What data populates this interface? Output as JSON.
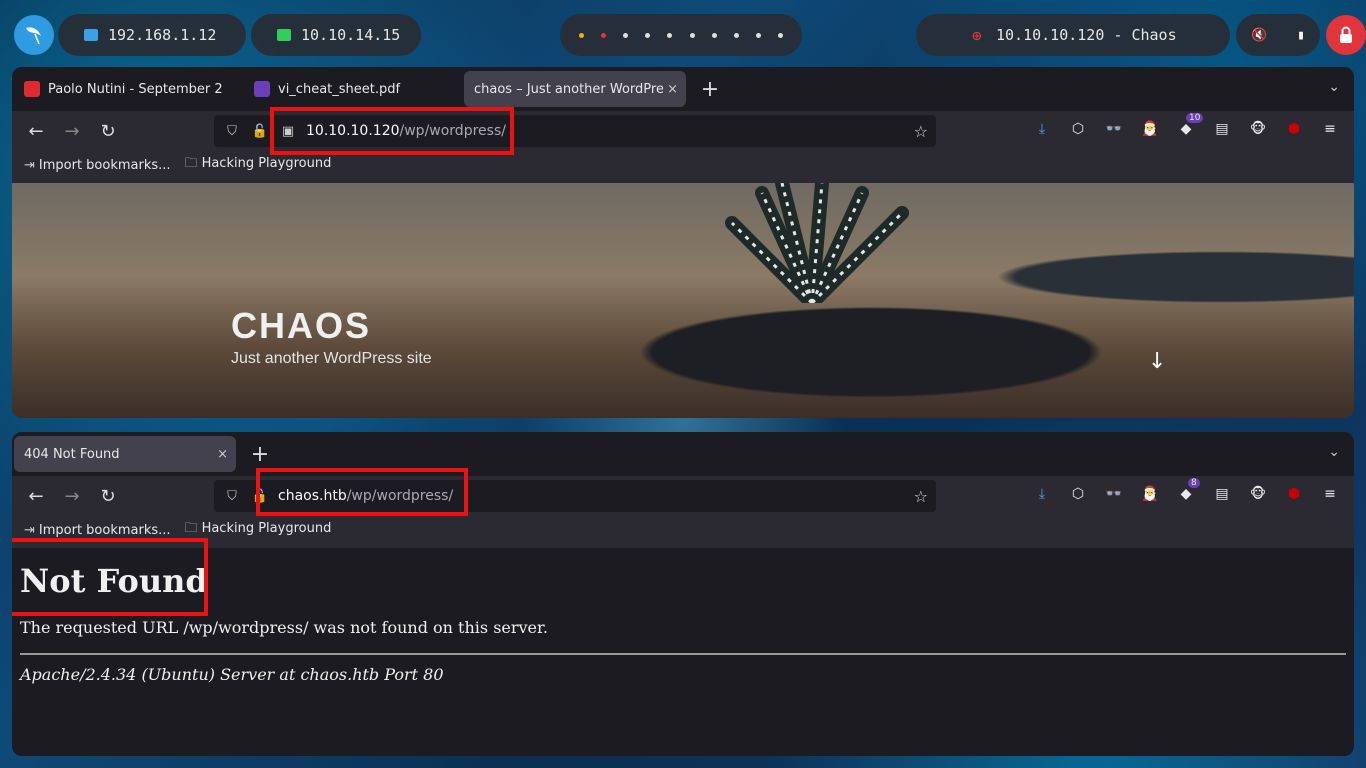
{
  "panel": {
    "ip_local": "192.168.1.12",
    "ip_vpn": "10.10.14.15",
    "target": "10.10.10.120 - Chaos",
    "colors": {
      "logo": "#2f9be0",
      "lock": "#e0353a",
      "ip_icon": "#3aa0e8",
      "vpn_icon": "#2fcf5a",
      "target_icon": "#e23a3a"
    }
  },
  "browser1": {
    "tabs": [
      {
        "label": "Paolo Nutini - September 2",
        "favicon": "youtube-icon"
      },
      {
        "label": "vi_cheat_sheet.pdf",
        "favicon": "pdf-icon"
      },
      {
        "label": "chaos – Just another WordPress",
        "favicon": "",
        "active": true
      }
    ],
    "url_host": "10.10.10.120",
    "url_path": "/wp/wordpress/",
    "bookmarks": [
      "Import bookmarks...",
      "Hacking Playground"
    ],
    "ext_badge": "10",
    "site_title": "CHAOS",
    "site_tagline": "Just another WordPress site"
  },
  "browser2": {
    "tabs": [
      {
        "label": "404 Not Found",
        "active": true
      }
    ],
    "url_host": "chaos.htb",
    "url_path": "/wp/wordpress/",
    "bookmarks": [
      "Import bookmarks...",
      "Hacking Playground"
    ],
    "ext_badge": "8",
    "heading": "Not Found",
    "message": "The requested URL /wp/wordpress/ was not found on this server.",
    "server_sig": "Apache/2.4.34 (Ubuntu) Server at chaos.htb Port 80"
  },
  "icons": {
    "close": "×",
    "new_tab": "+",
    "menu_chevron": "⌄",
    "back": "←",
    "forward": "→",
    "reload": "↻",
    "star": "☆",
    "down_arrow": "↓",
    "hamburger": "≡"
  }
}
